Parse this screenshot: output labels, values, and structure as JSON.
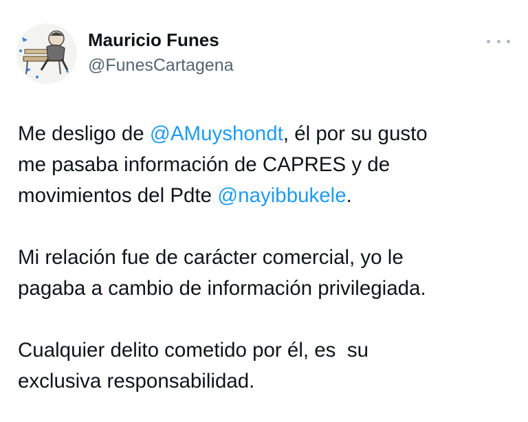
{
  "author": {
    "display_name": "Mauricio Funes",
    "handle": "@FunesCartagena"
  },
  "icons": {
    "avatar": "caricature-avatar-icon",
    "more": "more-horizontal-icon"
  },
  "colors": {
    "link": "#1d9bf0",
    "text": "#0f1419",
    "secondary": "#536471"
  },
  "tweet": {
    "p1": {
      "l1_a": "Me desligo de ",
      "l1_mention": "@AMuyshondt",
      "l1_b": ", él por su gusto",
      "l2": "me pasaba información de CAPRES y de",
      "l3_a": "movimientos del Pdte ",
      "l3_mention": "@nayibbukele",
      "l3_b": "."
    },
    "p2": {
      "l1": "Mi relación fue de carácter comercial, yo le",
      "l2": "pagaba a cambio de información privilegiada."
    },
    "p3": {
      "l1": "Cualquier delito cometido por él, es  su",
      "l2": "exclusiva responsabilidad."
    }
  }
}
